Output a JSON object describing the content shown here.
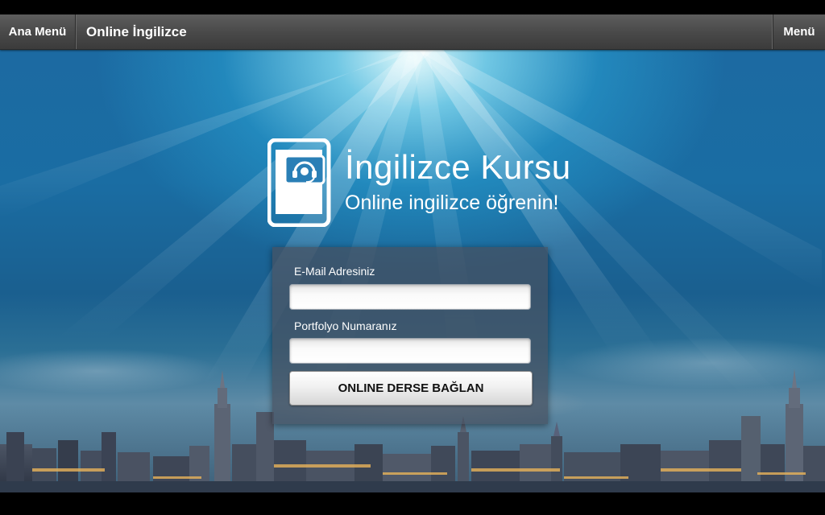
{
  "header": {
    "left_button": "Ana Menü",
    "title": "Online İngilizce",
    "right_button": "Menü"
  },
  "logo": {
    "title": "İngilizce Kursu",
    "subtitle": "Online ingilizce öğrenin!",
    "icon": "tablet-headset-icon"
  },
  "form": {
    "email_label": "E-Mail Adresiniz",
    "email_value": "",
    "portfolio_label": "Portfolyo Numaranız",
    "portfolio_value": "",
    "submit_label": "ONLINE DERSE BAĞLAN"
  },
  "colors": {
    "header": "#4a4a4a",
    "panel": "#46505f",
    "sky": "#1a6da3"
  }
}
